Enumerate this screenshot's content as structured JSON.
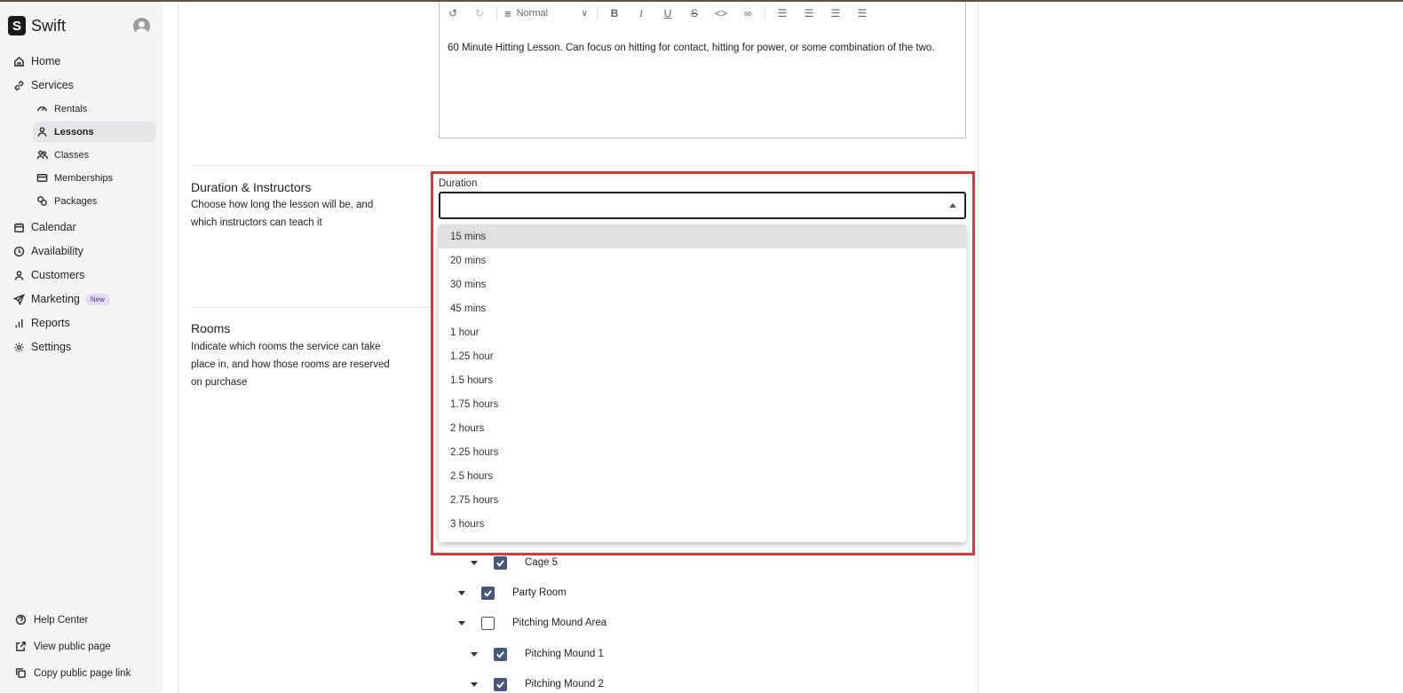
{
  "app": {
    "name": "Swift",
    "logo_letter": "S"
  },
  "sidebar": {
    "items": [
      {
        "label": "Home"
      },
      {
        "label": "Services"
      },
      {
        "label": "Calendar"
      },
      {
        "label": "Availability"
      },
      {
        "label": "Customers"
      },
      {
        "label": "Marketing",
        "badge": "New"
      },
      {
        "label": "Reports"
      },
      {
        "label": "Settings"
      }
    ],
    "sub_items": [
      {
        "label": "Rentals"
      },
      {
        "label": "Lessons"
      },
      {
        "label": "Classes"
      },
      {
        "label": "Memberships"
      },
      {
        "label": "Packages"
      }
    ],
    "footer": [
      {
        "label": "Help Center"
      },
      {
        "label": "View public page"
      },
      {
        "label": "Copy public page link"
      }
    ]
  },
  "editor": {
    "style_select": "Normal",
    "text": "60 Minute Hitting Lesson. Can focus on hitting for contact, hitting for power, or some combination of the two."
  },
  "duration_section": {
    "title": "Duration & Instructors",
    "description": "Choose how long the lesson will be, and which instructors can teach it",
    "field_label": "Duration",
    "value": "",
    "options": [
      "15 mins",
      "20 mins",
      "30 mins",
      "45 mins",
      "1 hour",
      "1.25 hour",
      "1.5 hours",
      "1.75 hours",
      "2 hours",
      "2.25 hours",
      "2.5 hours",
      "2.75 hours",
      "3 hours"
    ],
    "highlighted_option": "15 mins"
  },
  "rooms_section": {
    "title": "Rooms",
    "description": "Indicate which rooms the service can take place in, and how those rooms are reserved on purchase",
    "tree": [
      {
        "label": "Cage 5",
        "checked": true,
        "level": 2
      },
      {
        "label": "Party Room",
        "checked": true,
        "level": 1
      },
      {
        "label": "Pitching Mound Area",
        "checked": false,
        "level": 1
      },
      {
        "label": "Pitching Mound 1",
        "checked": true,
        "level": 2
      },
      {
        "label": "Pitching Mound 2",
        "checked": true,
        "level": 2
      }
    ]
  },
  "colors": {
    "highlight": "#d63a33",
    "checkbox": "#45587d",
    "badge_bg": "#e4dcf7"
  }
}
